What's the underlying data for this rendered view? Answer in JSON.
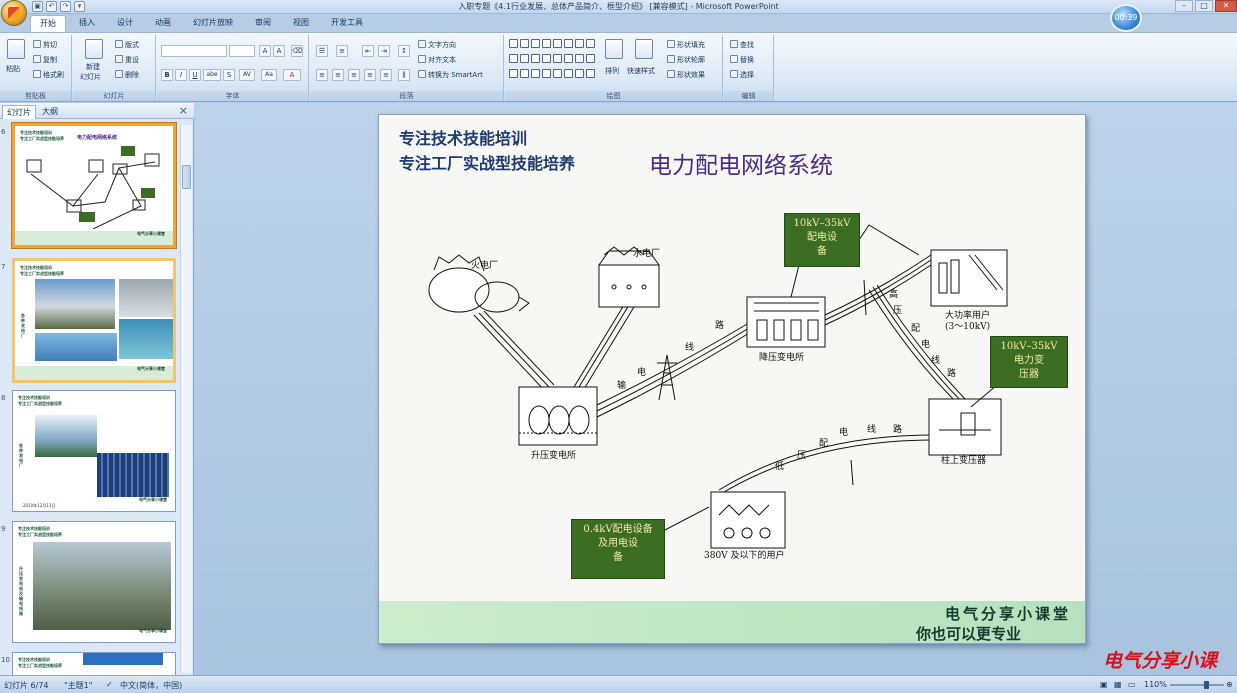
{
  "window": {
    "title": "入职专题《4.1行业发展、总体产品简介、框型介绍》 [兼容模式] - Microsoft PowerPoint",
    "timer": "00:39"
  },
  "ribbon": {
    "tabs": [
      "开始",
      "插入",
      "设计",
      "动画",
      "幻灯片放映",
      "审阅",
      "视图",
      "开发工具"
    ],
    "clipboard": {
      "paste": "粘贴",
      "cut": "剪切",
      "copy": "复制",
      "format_painter": "格式刷",
      "label": "剪贴板"
    },
    "slides": {
      "new_slide": "新建",
      "new_slide2": "幻灯片",
      "layout": "版式",
      "reset": "重设",
      "delete": "删除",
      "label": "幻灯片"
    },
    "font": {
      "label": "字体",
      "bold": "B",
      "italic": "I",
      "underline": "U",
      "strike": "abe",
      "shadow": "S",
      "spacing": "AV",
      "case": "Aa",
      "color": "A"
    },
    "paragraph": {
      "text_direction": "文字方向",
      "align_text": "对齐文本",
      "smartart": "转换为 SmartArt",
      "label": "段落"
    },
    "drawing": {
      "arrange": "排列",
      "quick_styles": "快速样式",
      "shape_fill": "形状填充",
      "shape_outline": "形状轮廓",
      "shape_effects": "形状效果",
      "label": "绘图"
    },
    "editing": {
      "find": "查找",
      "replace": "替换",
      "select": "选择",
      "label": "编辑"
    }
  },
  "panel": {
    "tabs": [
      "幻灯片",
      "大纲"
    ],
    "close": "×",
    "thumbnails": [
      {
        "num": "6",
        "title1": "专注技术技能培训",
        "title2": "专注工厂实战型技能培养",
        "heading": "电力配电网络系统",
        "footer": "电气分享小课堂"
      },
      {
        "num": "7",
        "title1": "专注技术技能培训",
        "title2": "专注工厂实战型技能培养",
        "side": "各种发电厂",
        "footer": "电气分享小课堂"
      },
      {
        "num": "8",
        "title1": "专注技术技能培训",
        "title2": "专注工厂实战型技能培养",
        "side": "各种发电厂",
        "date": "2010年12月13日",
        "footer": "电气分享小课堂"
      },
      {
        "num": "9",
        "title1": "专注技术技能培训",
        "title2": "专注工厂实战型技能培养",
        "side": "升压变电站及输电线路",
        "footer": "电气分享小课堂"
      },
      {
        "num": "10",
        "title1": "专注技术技能培训",
        "title2": "专注工厂实战型技能培养"
      }
    ]
  },
  "slide": {
    "title_line1": "专注技术技能培训",
    "title_line2": "专注工厂实战型技能培养",
    "main_title": "电力配电网络系统",
    "labels": {
      "thermal": "火电厂",
      "hydro": "水电厂",
      "stepup": "升压变电所",
      "stepdown": "降压变电所",
      "big_user": "大功率用户",
      "big_user_voltage": "(3～10kV)",
      "pole_transformer": "柱上变压器",
      "user_380": "380V 及以下的用户",
      "trans_line": [
        "输",
        "电",
        "线",
        "路"
      ],
      "hv_line": [
        "高",
        "压",
        "配",
        "电",
        "线",
        "路"
      ],
      "lv_line": [
        "低",
        "压",
        "配",
        "电",
        "线",
        "路"
      ]
    },
    "callouts": {
      "c1": [
        "10kV–35kV",
        "配电设",
        "备"
      ],
      "c2": [
        "10kV–35kV",
        "电力变",
        "压器"
      ],
      "c3": [
        "0.4kV配电设备",
        "及用电设",
        "备"
      ]
    },
    "footer1": "电气分享小课堂",
    "footer2": "你也可以更专业"
  },
  "watermark": "电气分享小课",
  "status": {
    "slide": "幻灯片 6/74",
    "theme": "\"主题1\"",
    "lang": "中文(简体，中国)",
    "zoom": "110%"
  }
}
